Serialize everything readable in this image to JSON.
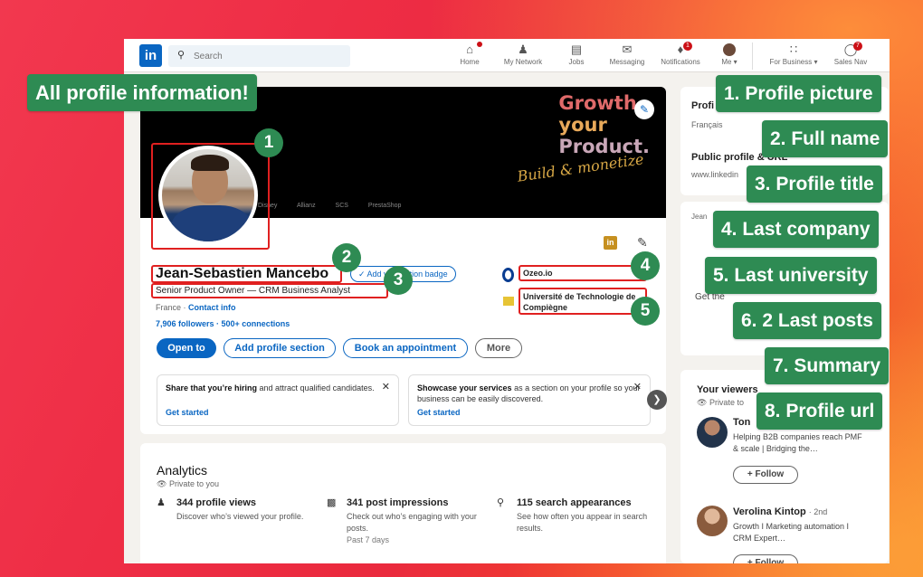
{
  "nav": {
    "search_placeholder": "Search",
    "items": [
      {
        "label": "Home",
        "icon": "home-icon",
        "badge": ""
      },
      {
        "label": "My Network",
        "icon": "network-icon",
        "badge": ""
      },
      {
        "label": "Jobs",
        "icon": "briefcase-icon",
        "badge": ""
      },
      {
        "label": "Messaging",
        "icon": "message-icon",
        "badge": ""
      },
      {
        "label": "Notifications",
        "icon": "bell-icon",
        "badge": "1"
      },
      {
        "label": "Me ▾",
        "icon": "avatar",
        "badge": ""
      },
      {
        "label": "For Business ▾",
        "icon": "grid-icon",
        "badge": ""
      },
      {
        "label": "Sales Nav",
        "icon": "compass-icon",
        "badge": "7"
      }
    ]
  },
  "banner": {
    "line1": "Growth",
    "line2": "your",
    "line3": "Product.",
    "script": "Build & monetize",
    "logos": "Disney Allianz SCS PrestaShop"
  },
  "profile": {
    "name": "Jean-Sebastien Mancebo",
    "verify_badge": "Add verification badge",
    "headline": "Senior Product Owner — CRM Business Analyst",
    "location": "France",
    "contact_info": "Contact info",
    "followers": "7,906 followers",
    "connections": "500+ connections",
    "company": "Ozeo.io",
    "university": "Université de Technologie de Compiègne"
  },
  "actions": {
    "open_to": "Open to",
    "add_section": "Add profile section",
    "appointment": "Book an appointment",
    "more": "More"
  },
  "promos": [
    {
      "bold": "Share that you’re hiring",
      "text": " and attract qualified candidates.",
      "cta": "Get started"
    },
    {
      "bold": "Showcase your services",
      "text": " as a section on your profile so your business can be easily discovered.",
      "cta": "Get started"
    }
  ],
  "analytics": {
    "title": "Analytics",
    "subtitle": "Private to you",
    "stats": [
      {
        "title": "344 profile views",
        "desc": "Discover who’s viewed your profile.",
        "note": ""
      },
      {
        "title": "341 post impressions",
        "desc": "Check out who’s engaging with your posts.",
        "note": "Past 7 days"
      },
      {
        "title": "115 search appearances",
        "desc": "See how often you appear in search results.",
        "note": ""
      }
    ]
  },
  "right": {
    "profile_lang_title": "Profi",
    "profile_lang_value": "Français",
    "public_profile_title": "Public profile & URL",
    "public_profile_url": "www.linkedin",
    "ad_small": "Jean",
    "ad_text": "Get the",
    "viewers_title": "Your viewers",
    "viewers_sub": "Private to",
    "viewer1_name": "Ton",
    "viewer1_desc": "Helping B2B companies reach PMF & scale | Bridging the…",
    "viewer2_name": "Verolina Kintop",
    "viewer2_degree": "· 2nd",
    "viewer2_desc": "Growth I Marketing automation I CRM Expert…",
    "follow_label": "+ Follow"
  },
  "annotations": {
    "header": "All profile information!",
    "labels": [
      "1. Profile picture",
      "2. Full name",
      "3. Profile title",
      "4. Last company",
      "5. Last university",
      "6. 2 Last posts",
      "7. Summary",
      "8. Profile url"
    ],
    "numbers": [
      "1",
      "2",
      "3",
      "4",
      "5"
    ]
  },
  "colors": {
    "linkedin_blue": "#0a66c2",
    "annotation_green": "#2e8b53",
    "highlight_red": "#e02020"
  }
}
